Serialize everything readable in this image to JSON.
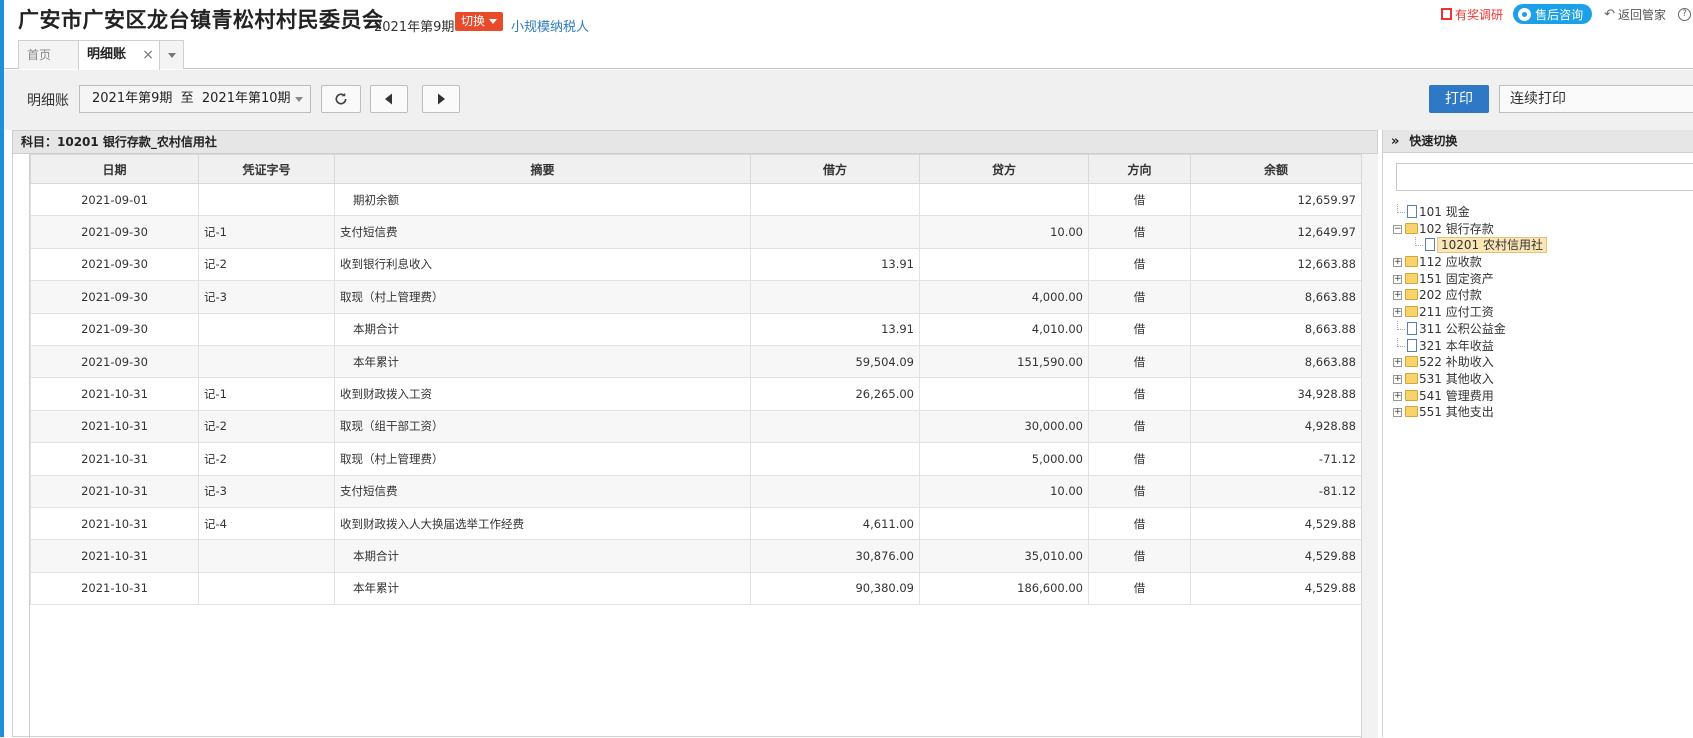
{
  "header": {
    "org_title": "广安市广安区龙台镇青松村村民委员会",
    "period": "2021年第9期",
    "switch_label": "切换",
    "taxpayer_type": "小规模纳税人",
    "research_label": "有奖调研",
    "consult_label": "售后咨询",
    "back_label": "返回管家"
  },
  "tabs": [
    {
      "label": "首页"
    },
    {
      "label": "明细账",
      "close": "×"
    }
  ],
  "toolbar": {
    "label": "明细账",
    "range": "2021年第9期  至  2021年第10期",
    "print_label": "打印",
    "continuous_print_label": "连续打印"
  },
  "subject": "科目：10201  银行存款_农村信用社",
  "columns": [
    "日期",
    "凭证字号",
    "摘要",
    "借方",
    "贷方",
    "方向",
    "余额"
  ],
  "rows": [
    {
      "date": "2021-09-01",
      "voucher": "",
      "summary": "期初余额",
      "debit": "",
      "credit": "",
      "dir": "借",
      "balance": "12,659.97",
      "sub": true
    },
    {
      "date": "2021-09-30",
      "voucher": "记-1",
      "summary": "支付短信费",
      "debit": "",
      "credit": "10.00",
      "dir": "借",
      "balance": "12,649.97",
      "sub": false
    },
    {
      "date": "2021-09-30",
      "voucher": "记-2",
      "summary": "收到银行利息收入",
      "debit": "13.91",
      "credit": "",
      "dir": "借",
      "balance": "12,663.88",
      "sub": false
    },
    {
      "date": "2021-09-30",
      "voucher": "记-3",
      "summary": "取现（村上管理费）",
      "debit": "",
      "credit": "4,000.00",
      "dir": "借",
      "balance": "8,663.88",
      "sub": false
    },
    {
      "date": "2021-09-30",
      "voucher": "",
      "summary": "本期合计",
      "debit": "13.91",
      "credit": "4,010.00",
      "dir": "借",
      "balance": "8,663.88",
      "sub": true
    },
    {
      "date": "2021-09-30",
      "voucher": "",
      "summary": "本年累计",
      "debit": "59,504.09",
      "credit": "151,590.00",
      "dir": "借",
      "balance": "8,663.88",
      "sub": true
    },
    {
      "date": "2021-10-31",
      "voucher": "记-1",
      "summary": "收到财政拨入工资",
      "debit": "26,265.00",
      "credit": "",
      "dir": "借",
      "balance": "34,928.88",
      "sub": false
    },
    {
      "date": "2021-10-31",
      "voucher": "记-2",
      "summary": "取现（组干部工资）",
      "debit": "",
      "credit": "30,000.00",
      "dir": "借",
      "balance": "4,928.88",
      "sub": false
    },
    {
      "date": "2021-10-31",
      "voucher": "记-2",
      "summary": "取现（村上管理费）",
      "debit": "",
      "credit": "5,000.00",
      "dir": "借",
      "balance": "-71.12",
      "sub": false
    },
    {
      "date": "2021-10-31",
      "voucher": "记-3",
      "summary": "支付短信费",
      "debit": "",
      "credit": "10.00",
      "dir": "借",
      "balance": "-81.12",
      "sub": false
    },
    {
      "date": "2021-10-31",
      "voucher": "记-4",
      "summary": "收到财政拨入人大换届选举工作经费",
      "debit": "4,611.00",
      "credit": "",
      "dir": "借",
      "balance": "4,529.88",
      "sub": false
    },
    {
      "date": "2021-10-31",
      "voucher": "",
      "summary": "本期合计",
      "debit": "30,876.00",
      "credit": "35,010.00",
      "dir": "借",
      "balance": "4,529.88",
      "sub": true
    },
    {
      "date": "2021-10-31",
      "voucher": "",
      "summary": "本年累计",
      "debit": "90,380.09",
      "credit": "186,600.00",
      "dir": "借",
      "balance": "4,529.88",
      "sub": true
    }
  ],
  "quick_switch": {
    "title": "快速切换",
    "search_placeholder": "",
    "tree": [
      {
        "label": "101 现金",
        "type": "doc",
        "expander": "",
        "level": 0
      },
      {
        "label": "102 银行存款",
        "type": "folder",
        "expander": "−",
        "level": 0
      },
      {
        "label": "10201 农村信用社",
        "type": "doc",
        "expander": "",
        "level": 1,
        "selected": true
      },
      {
        "label": "112 应收款",
        "type": "folder",
        "expander": "+",
        "level": 0
      },
      {
        "label": "151 固定资产",
        "type": "folder",
        "expander": "+",
        "level": 0
      },
      {
        "label": "202 应付款",
        "type": "folder",
        "expander": "+",
        "level": 0
      },
      {
        "label": "211 应付工资",
        "type": "folder",
        "expander": "+",
        "level": 0
      },
      {
        "label": "311 公积公益金",
        "type": "doc",
        "expander": "",
        "level": 0
      },
      {
        "label": "321 本年收益",
        "type": "doc",
        "expander": "",
        "level": 0
      },
      {
        "label": "522 补助收入",
        "type": "folder",
        "expander": "+",
        "level": 0
      },
      {
        "label": "531 其他收入",
        "type": "folder",
        "expander": "+",
        "level": 0
      },
      {
        "label": "541 管理费用",
        "type": "folder",
        "expander": "+",
        "level": 0
      },
      {
        "label": "551 其他支出",
        "type": "folder",
        "expander": "+",
        "level": 0
      }
    ]
  },
  "colors": {
    "accent": "#2e78c5",
    "switch": "#e84a2a",
    "consult": "#1ca0e8",
    "link": "#2f7bbf"
  }
}
